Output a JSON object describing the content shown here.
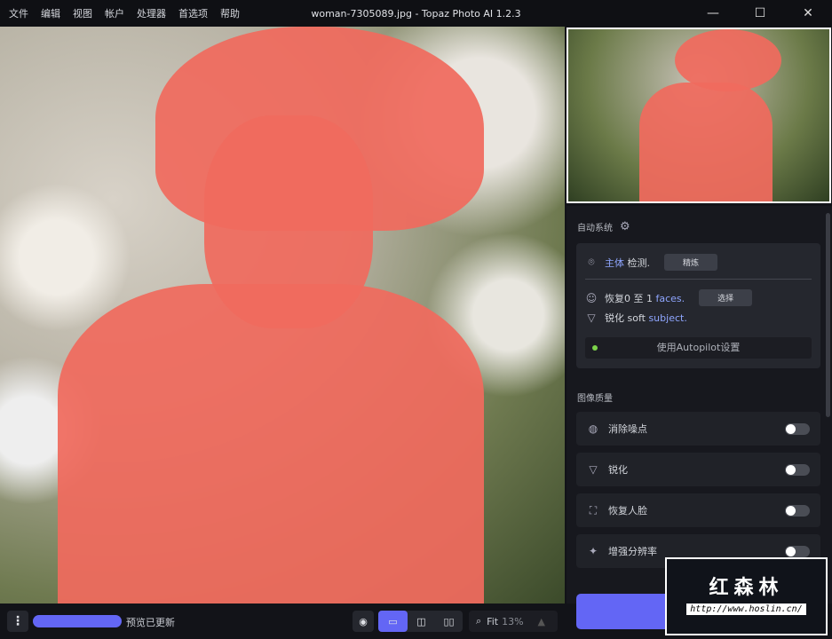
{
  "menu": [
    "文件",
    "编辑",
    "视图",
    "帐户",
    "处理器",
    "首选项",
    "帮助"
  ],
  "window": {
    "title": "woman-7305089.jpg - Topaz Photo AI 1.2.3",
    "minimize": "—",
    "maximize": "☐",
    "close": "✕"
  },
  "autopilot": {
    "heading": "自动系统",
    "subject_label": "主体",
    "subject_text": "检测.",
    "refine_button": "精炼",
    "faces_text": "恢复0 至 1",
    "faces_label": "faces.",
    "select_button": "选择",
    "sharpen_text": "锐化 soft",
    "sharpen_label": "subject.",
    "use_settings": "使用Autopilot设置"
  },
  "quality": {
    "heading": "图像质量",
    "items": [
      {
        "label": "消除噪点",
        "enabled": false
      },
      {
        "label": "锐化",
        "enabled": false
      },
      {
        "label": "恢复人脸",
        "enabled": false
      },
      {
        "label": "增强分辨率",
        "enabled": false
      }
    ]
  },
  "bottom": {
    "status": "预览已更新",
    "progress": 1.0,
    "zoom_label": "Fit",
    "zoom_value": "13%"
  },
  "watermark": {
    "title": "红森林",
    "url": "http://www.hoslin.cn/"
  },
  "colors": {
    "accent": "#6366f5",
    "mask": "#f06a5e"
  }
}
